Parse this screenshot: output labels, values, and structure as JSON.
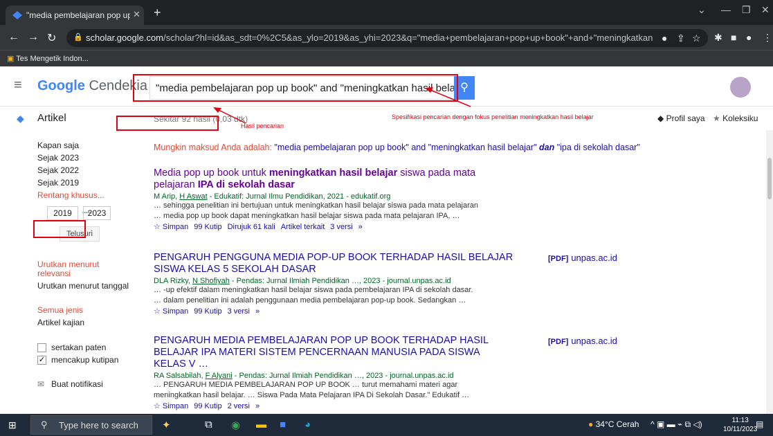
{
  "browser": {
    "tab_title": "\"media pembelajaran pop up bo",
    "url_host": "scholar.google.com",
    "url_path": "/scholar?hl=id&as_sdt=0%2C5&as_ylo=2019&as_yhi=2023&q=\"media+pembelajaran+pop+up+book\"+and+\"meningkatkan+hasil+belaj...",
    "bookmark": "Tes Mengetik Indon..."
  },
  "header": {
    "logo_google": "Google",
    "logo_product": " Cendekia",
    "query": "\"media pembelajaran pop up book\" and \"meningkatkan hasil belajar\" and \"ipa"
  },
  "subheader": {
    "section": "Artikel",
    "count": "Sekitar 92 hasil (0,03 dtk)",
    "profile": "Profil saya",
    "collection": "Koleksiku"
  },
  "sidebar": {
    "time_items": [
      "Kapan saja",
      "Sejak 2023",
      "Sejak 2022",
      "Sejak 2019"
    ],
    "custom_range": "Rentang khusus...",
    "year_from": "2019",
    "year_to": "2023",
    "year_sep": "—",
    "search_btn": "Telusuri",
    "sort_relevance": "Urutkan menurut relevansi",
    "sort_date": "Urutkan menurut tanggal",
    "type_all": "Semua jenis",
    "type_review": "Artikel kajian",
    "include_patents": "sertakan paten",
    "include_citations": "mencakup kutipan",
    "alert": "Buat notifikasi"
  },
  "did_you_mean": {
    "prefix": "Mungkin maksud Anda adalah: ",
    "q1": "\"media pembelajaran pop up book\" and \"meningkatkan hasil belajar\" ",
    "q2": "dan",
    "q3": " \"ipa di sekolah dasar\""
  },
  "results": [
    {
      "title_a": "Media pop up book untuk ",
      "title_b": "meningkatkan hasil belajar",
      "title_c": " siswa pada mata pelajaran ",
      "title_d": "IPA di sekolah dasar",
      "meta_a": "M Arip, ",
      "meta_b": "H Aswat",
      "meta_c": " - Edukatif: Jurnal Ilmu Pendidikan, 2021 - edukatif.org",
      "snip1": "… sehingga penelitian ini bertujuan untuk meningkatkan hasil belajar siswa pada mata pelajaran",
      "snip2": "… media pop up book dapat meningkatkan hasil belajar siswa pada mata pelajaran IPA, …",
      "actions": [
        "☆ Simpan",
        "99 Kutip",
        "Dirujuk 61 kali",
        "Artikel terkait",
        "3 versi",
        "»"
      ]
    },
    {
      "title": "PENGARUH PENGGUNA MEDIA POP-UP BOOK TERHADAP HASIL BELAJAR SISWA KELAS 5 SEKOLAH DASAR",
      "meta_a": "DLA Rizky, ",
      "meta_b": "N Shofiyah",
      "meta_c": " - Pendas: Jurnal Ilmiah Pendidikan …, 2023 - journal.unpas.ac.id",
      "snip1": "… -up efektif dalam meningkatkan hasil belajar siswa pada pembelajaran IPA di sekolah dasar.",
      "snip2": "… dalam penelitian ini adalah penggunaan media pembelajaran pop-up book. Sedangkan …",
      "actions": [
        "☆ Simpan",
        "99 Kutip",
        "3 versi",
        "»"
      ],
      "pdf_tag": "[PDF]",
      "pdf_host": "unpas.ac.id"
    },
    {
      "title": "PENGARUH MEDIA PEMBELAJARAN POP UP BOOK TERHADAP HASIL BELAJAR IPA MATERI SISTEM PENCERNAAN MANUSIA PADA SISWA KELAS V …",
      "meta_a": "RA Salsabilah, ",
      "meta_b": "F Alyani",
      "meta_c": " - Pendas: Jurnal Ilmiah Pendidikan …, 2023 - journal.unpas.ac.id",
      "snip1": "… PENGARUH MEDIA PEMBELAJARAN POP UP BOOK … turut memahami materi agar",
      "snip2": "meningkatkan hasil belajar. … Siswa Pada Mata Pelajaran IPA Di Sekolah Dasar.\" Edukatif …",
      "actions": [
        "☆ Simpan",
        "99 Kutip",
        "2 versi",
        "»"
      ],
      "pdf_tag": "[PDF]",
      "pdf_host": "unpas.ac.id"
    }
  ],
  "annotations": {
    "hasil": "Hasil pencarian",
    "spesifikasi": "Spesifikasi pencarian dengan fokus penelitian meningkatkan hasil belajar"
  },
  "taskbar": {
    "search": "Type here to search",
    "weather": "34°C Cerah",
    "time": "11:13",
    "date": "10/11/2023"
  },
  "colors": {
    "link": "#1a0dab",
    "visited": "#660099",
    "accent": "#4285f4",
    "red": "#dd4b39",
    "annotation": "#e0000f"
  }
}
